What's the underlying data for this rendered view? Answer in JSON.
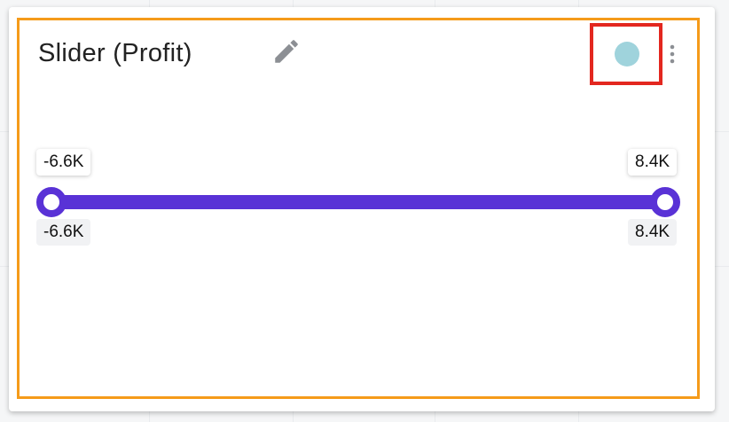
{
  "widget": {
    "title": "Slider (Profit)",
    "status_color": "#9fd3dc",
    "accent_color": "#5932d6",
    "border_color": "#f59b1a",
    "highlight_color": "#e3271f",
    "icons": {
      "edit": "pencil-icon",
      "menu": "kebab-vertical-icon"
    }
  },
  "slider": {
    "range_min_label": "-6.6K",
    "range_max_label": "8.4K",
    "selected_min_label": "-6.6K",
    "selected_max_label": "8.4K",
    "selected_fraction": [
      0,
      1
    ]
  }
}
